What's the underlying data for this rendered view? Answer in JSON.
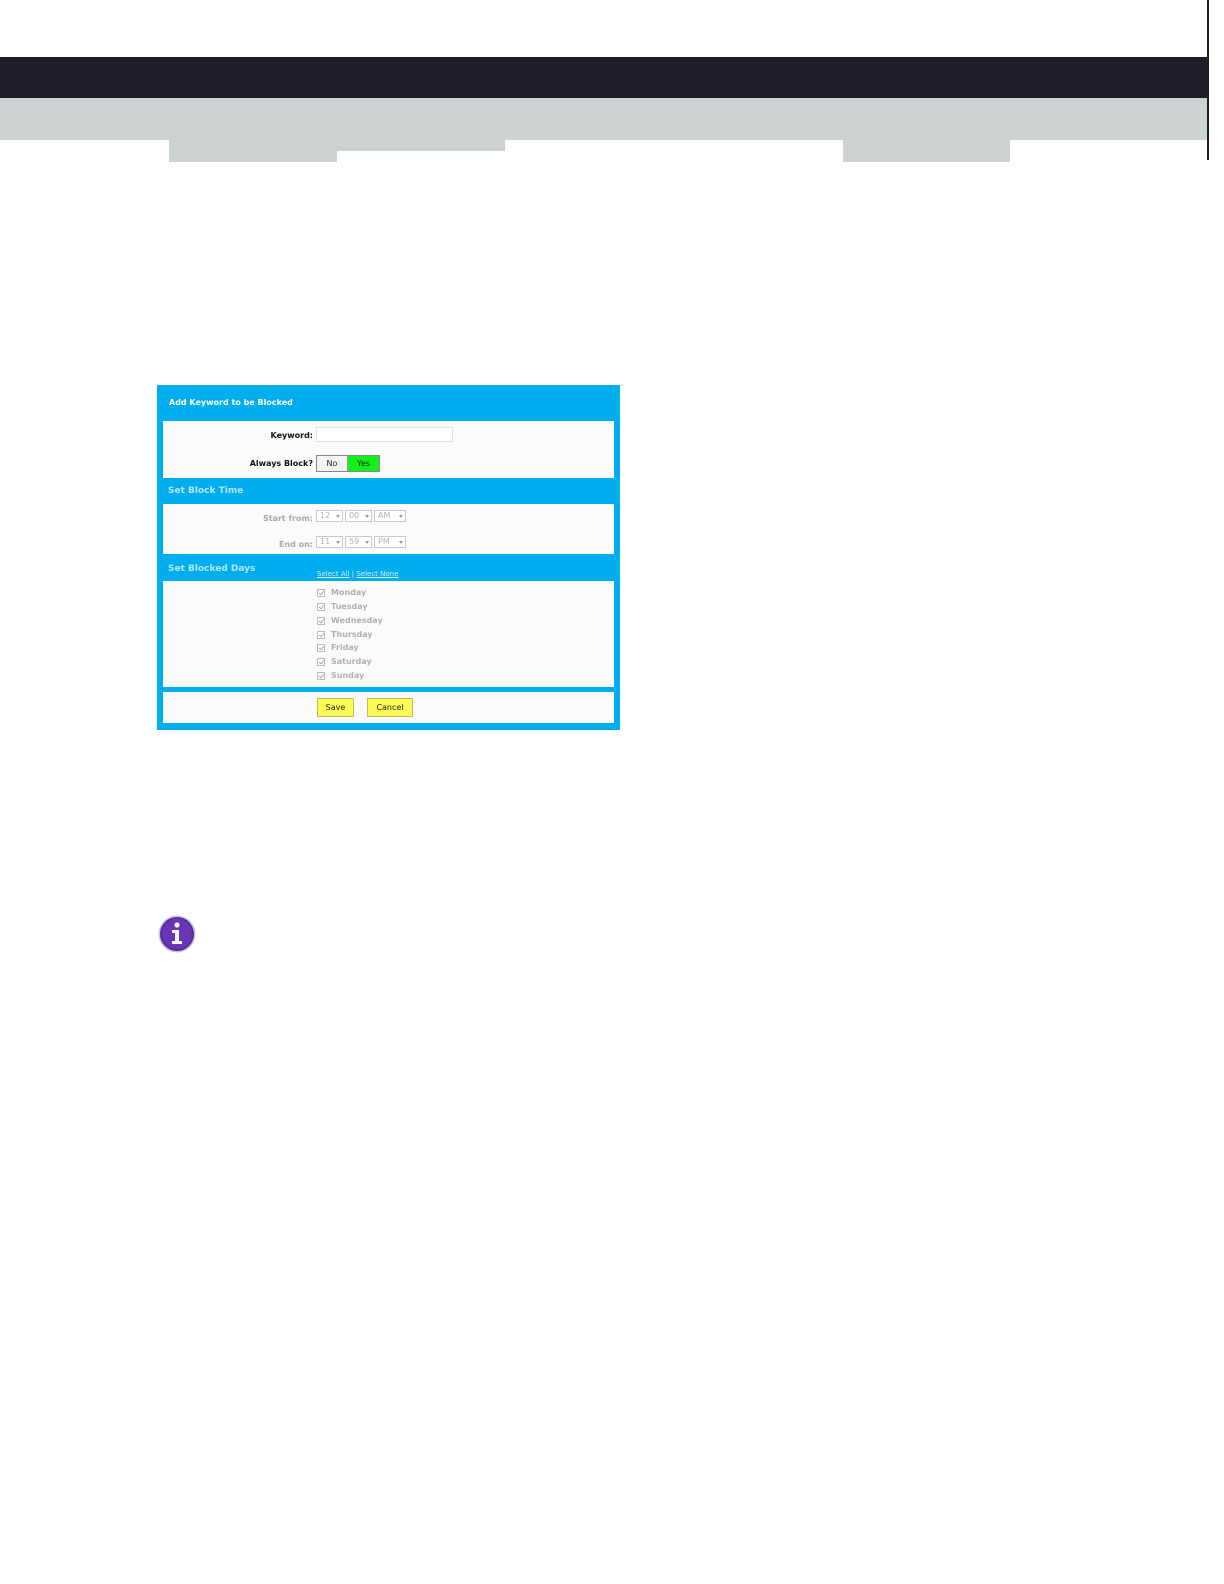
{
  "colors": {
    "top_bar": "#1e1f26",
    "sub_bar": "#cdd3d3",
    "dialog_bg": "#00adef",
    "toggle_yes": "#16f01a",
    "button_bg": "#fcfc55",
    "info_icon": "#5b2ca0"
  },
  "dialog": {
    "title": "Add Keyword to be Blocked",
    "keyword_label": "Keyword:",
    "keyword_value": "",
    "always_block_label": "Always Block?",
    "always_block_options": {
      "no": "No",
      "yes": "Yes"
    },
    "always_block_selected": "Yes",
    "block_time_title": "Set Block Time",
    "start_label": "Start from:",
    "start": {
      "hour": "12",
      "minute": "00",
      "ampm": "AM"
    },
    "end_label": "End on:",
    "end": {
      "hour": "11",
      "minute": "59",
      "ampm": "PM"
    },
    "blocked_days_title": "Set Blocked Days",
    "select_all": "Select All",
    "separator": "|",
    "select_none": "Select None",
    "days": [
      "Monday",
      "Tuesday",
      "Wednesday",
      "Thursday",
      "Friday",
      "Saturday",
      "Sunday"
    ],
    "save_label": "Save",
    "cancel_label": "Cancel"
  },
  "icons": {
    "info": "info-icon"
  }
}
